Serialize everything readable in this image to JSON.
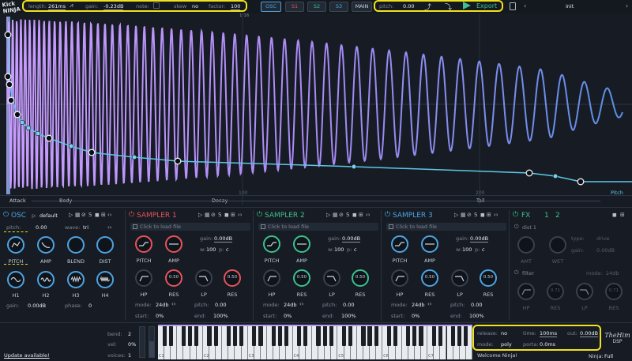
{
  "colors": {
    "background": "#171c24",
    "highlight": "#f2e21c",
    "osc": "#4ea3e2",
    "sampler": "#e5535c",
    "sampler2": "#3cc08e",
    "sampler3": "#4ea3e2",
    "fx": "#3cc08e",
    "export": "#3cc08e",
    "pitch_curve": "#5ec6e6",
    "wave_start": "#c084fc",
    "wave_end": "#5a8fe6"
  },
  "logo": {
    "line1": "Kick",
    "line2": "NINJA"
  },
  "topbar": {
    "length_label": "length:",
    "length_value": "261ms",
    "gain_label": "gain:",
    "gain_value": "-0.23dB",
    "note_label": "note:",
    "skew_label": "skew",
    "skew_value": "no",
    "factor_label": "factor:",
    "factor_value": "100",
    "grid_div": "1/16",
    "tabs": [
      "OSC",
      "S1",
      "S2",
      "S3",
      "MAIN"
    ],
    "pitch_label": "pitch:",
    "pitch_value": "0.00",
    "export_label": "Export",
    "preset_name": "init"
  },
  "graph": {
    "segments": [
      "Attack",
      "Body",
      "Decay",
      "Tail"
    ],
    "ticks": [
      "100",
      "200"
    ],
    "pitch_label": "Pitch"
  },
  "osc": {
    "title": "OSC",
    "p_label": "p:",
    "p_value": "default",
    "pitch_label": "pitch:",
    "pitch_value": "0.00",
    "wave_label": "wave:",
    "wave_value": "tri",
    "knobs": [
      "PITCH",
      "AMP",
      "BLEND",
      "DIST",
      "H1",
      "H2",
      "H3",
      "H4"
    ],
    "gain_label": "gain:",
    "gain_value": "0.00dB",
    "phase_label": "phase:",
    "phase_value": "0"
  },
  "samplers": [
    {
      "title": "SAMPLER 1",
      "load": "Click to load file",
      "gain_label": "gain:",
      "gain_value": "0.00dB",
      "w_label": "w:",
      "w_value": "100",
      "p_label": "p:",
      "p_value": "c",
      "knobs": [
        "PITCH",
        "AMP",
        "HP",
        "RES",
        "LP",
        "RES"
      ],
      "res1": "0.50",
      "res2": "0.50",
      "mode_label": "mode:",
      "mode_value": "24db",
      "pitch_label": "pitch:",
      "pitch_value": "0.00",
      "start_label": "start:",
      "start_value": "0%",
      "end_label": "end:",
      "end_value": "100%"
    },
    {
      "title": "SAMPLER 2",
      "load": "Click to load file",
      "gain_label": "gain:",
      "gain_value": "0.00dB",
      "w_label": "w:",
      "w_value": "100",
      "p_label": "p:",
      "p_value": "c",
      "knobs": [
        "PITCH",
        "AMP",
        "HP",
        "RES",
        "LP",
        "RES"
      ],
      "res1": "0.50",
      "res2": "0.50",
      "mode_label": "mode:",
      "mode_value": "24db",
      "pitch_label": "pitch:",
      "pitch_value": "0.00",
      "start_label": "start:",
      "start_value": "0%",
      "end_label": "end:",
      "end_value": "100%"
    },
    {
      "title": "SAMPLER 3",
      "load": "Click to load file",
      "gain_label": "gain:",
      "gain_value": "0.00dB",
      "w_label": "w:",
      "w_value": "100",
      "p_label": "p:",
      "p_value": "c",
      "knobs": [
        "PITCH",
        "AMP",
        "HP",
        "RES",
        "LP",
        "RES"
      ],
      "res1": "0.50",
      "res2": "0.50",
      "mode_label": "mode:",
      "mode_value": "24db",
      "pitch_label": "pitch:",
      "pitch_value": "0.00",
      "start_label": "start:",
      "start_value": "0%",
      "end_label": "end:",
      "end_value": "100%"
    }
  ],
  "fx": {
    "title": "FX",
    "tab1": "1",
    "tab2": "2",
    "dist_label": "dist 1",
    "type_label": "type:",
    "type_value": "drive",
    "gain_label": "gain:",
    "gain_value": "0.00dB",
    "amt_label": "AMT",
    "wet_label": "WET",
    "filter_label": "filter",
    "mode_label": "mode:",
    "mode_value": "24db",
    "knobs": [
      "HP",
      "RES",
      "LP",
      "RES"
    ],
    "res1": "0.71",
    "res2": "0.71"
  },
  "bottom": {
    "bend_label": "bend:",
    "bend_value": "2",
    "vel_label": "vel:",
    "vel_value": "0%",
    "voices_label": "voices:",
    "voices_value": "1",
    "octaves": [
      "C1",
      "C2",
      "C3",
      "C4",
      "C5",
      "C6",
      "C7"
    ],
    "release_label": "release:",
    "release_value": "no",
    "time_label": "time:",
    "time_value": "100ms",
    "out_label": "out:",
    "out_value": "0.00dB",
    "mode_label": "mode:",
    "mode_value": "poly",
    "porta_label": "porta:",
    "porta_value": "0.0ms",
    "welcome": "Welcome Ninja!",
    "update": "Update available!",
    "brand_line1": "TheHim",
    "brand_line2": "DSP",
    "ninja_label": "Ninja:",
    "ninja_value": "Full"
  }
}
